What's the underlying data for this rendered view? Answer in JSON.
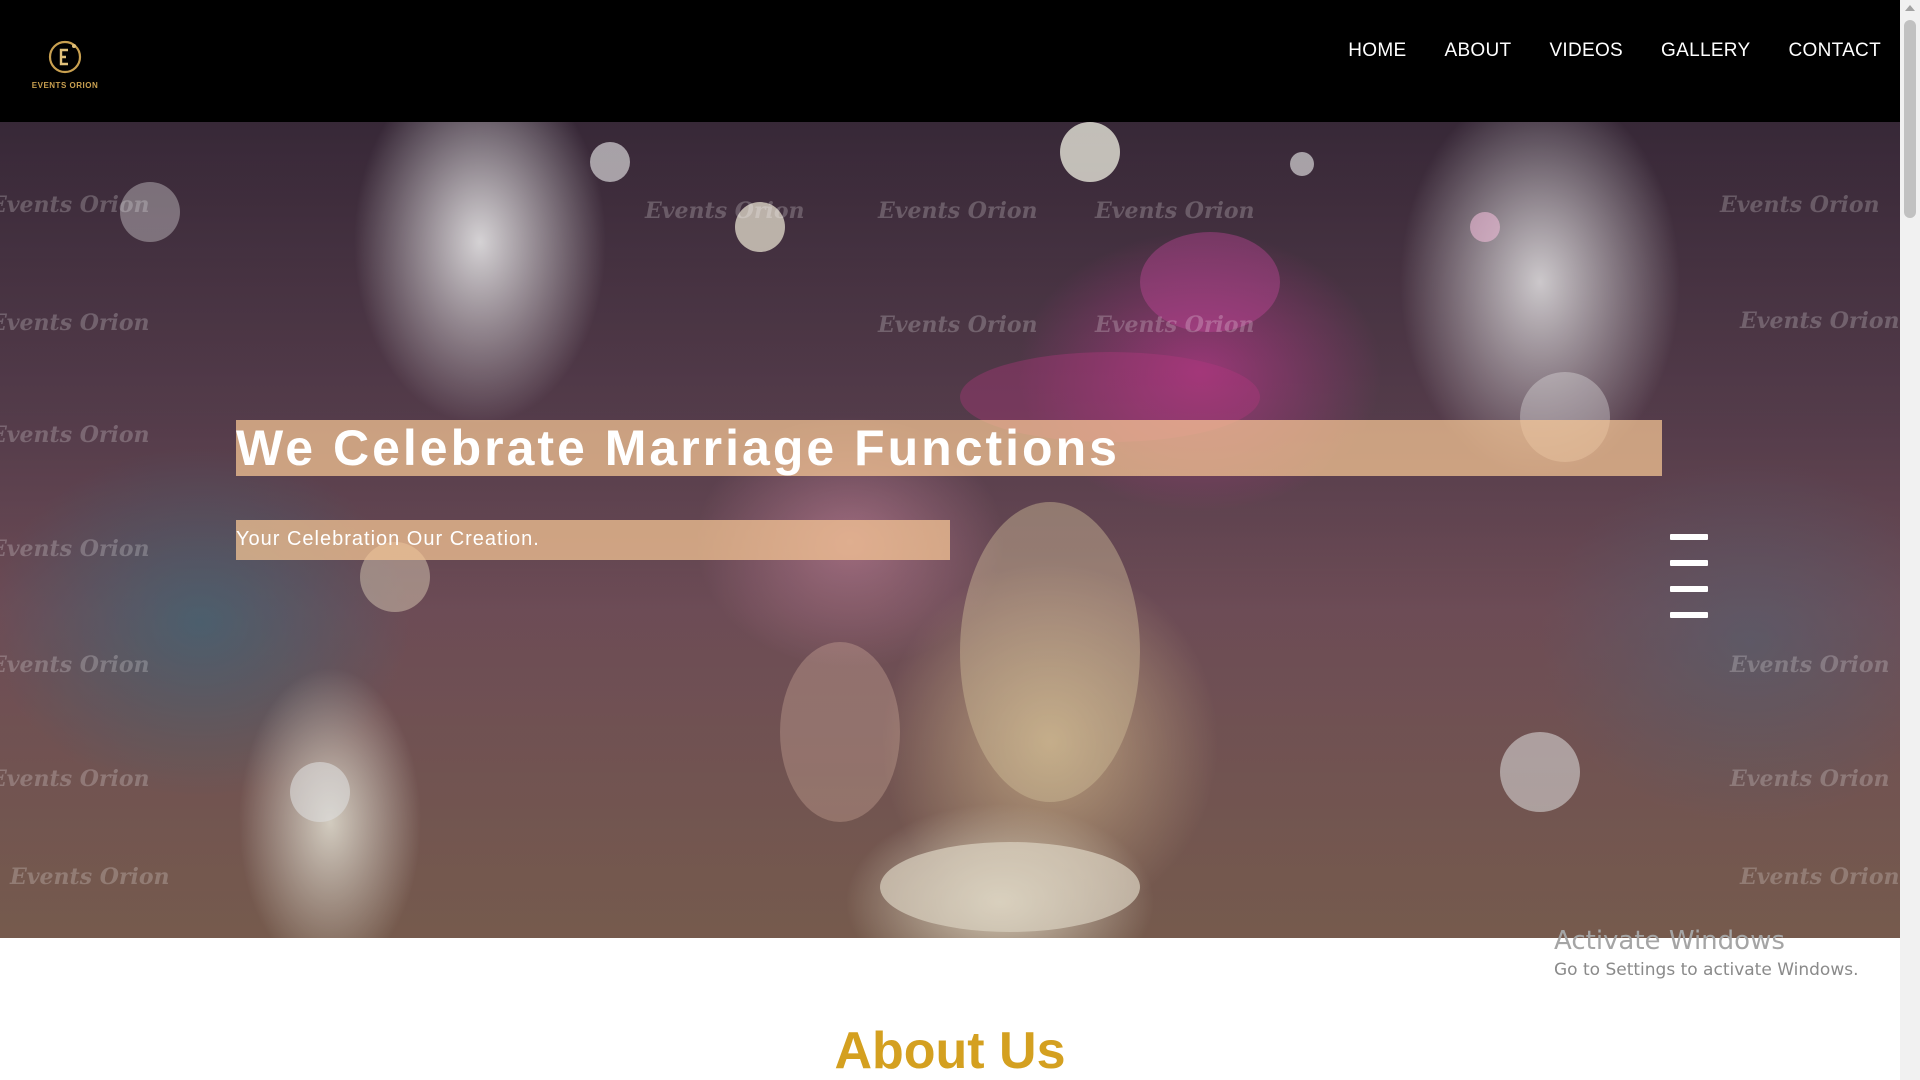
{
  "header": {
    "logo_text": "EVENTS ORION",
    "nav": [
      {
        "label": "HOME"
      },
      {
        "label": "ABOUT"
      },
      {
        "label": "VIDEOS"
      },
      {
        "label": "GALLERY"
      },
      {
        "label": "CONTACT"
      }
    ]
  },
  "hero": {
    "title": "We Celebrate Marriage Functions",
    "subtitle": "Your Celebration Our Creation.",
    "watermark_text": "Events Orion"
  },
  "about": {
    "heading": "About Us"
  },
  "os_notice": {
    "title": "Activate Windows",
    "subtitle": "Go to Settings to activate Windows."
  },
  "colors": {
    "header_bg": "#000000",
    "accent_gold": "#d4a020",
    "logo_gold": "#c9a050",
    "band_peach": "#f8c896"
  }
}
